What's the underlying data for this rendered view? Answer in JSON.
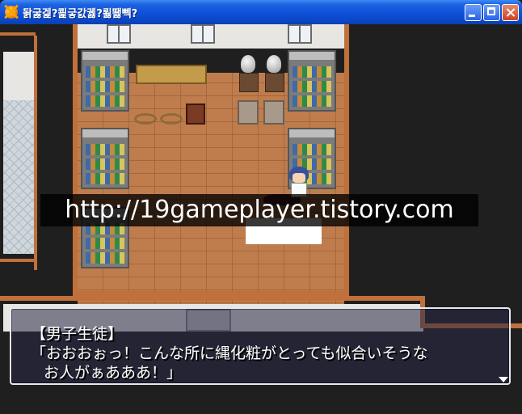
{
  "window": {
    "title": "돩굻겙?쾵긓갌궳?뢿뙗뻭?",
    "icon": "app-icon",
    "controls": [
      "minimize-icon",
      "maximize-icon",
      "close-icon"
    ]
  },
  "watermark": {
    "text": "http://19gameplayer.tistory.com"
  },
  "message": {
    "speaker": "【男子生徒】",
    "lines": [
      "「おおおぉっ！こんな所に縄化粧がとっても似合いそうな",
      "お人がぁあああ！」"
    ],
    "next_indicator": "triangle-down-icon"
  },
  "colors": {
    "titlebar": "#0d50d8",
    "floor": "#bf7d4d",
    "message_border": "#e8e8f4"
  }
}
